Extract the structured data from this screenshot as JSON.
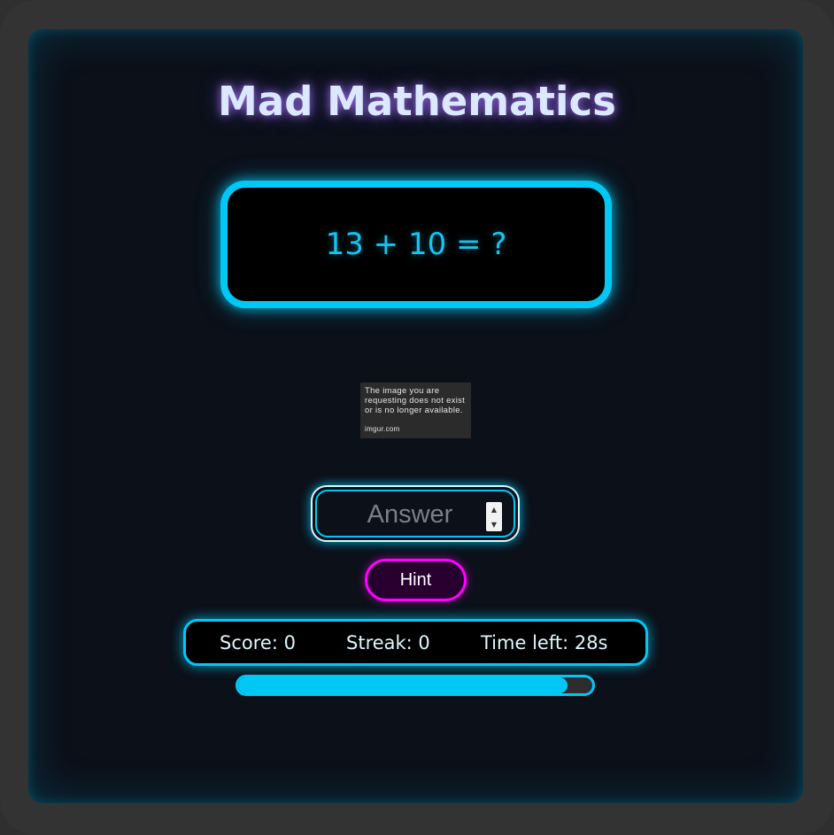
{
  "title": "Mad Mathematics",
  "question": "13 + 10 = ?",
  "broken_image": {
    "line1": "The image you are",
    "line2": "requesting does not exist",
    "line3": "or is no longer available.",
    "site": "imgur.com"
  },
  "answer_input": {
    "placeholder": "Answer",
    "value": ""
  },
  "hint_button": {
    "label": "Hint"
  },
  "stats": {
    "score": "Score: 0",
    "streak": "Streak: 0",
    "time_left": "Time left: 28s"
  },
  "timer_progress": 0.93,
  "colors": {
    "accent": "#00c8f5",
    "hint_accent": "#ff00ff",
    "panel_bg": "#0b1019"
  },
  "icons": {
    "spinner_up": "triangle-up-icon",
    "spinner_down": "triangle-down-icon"
  }
}
